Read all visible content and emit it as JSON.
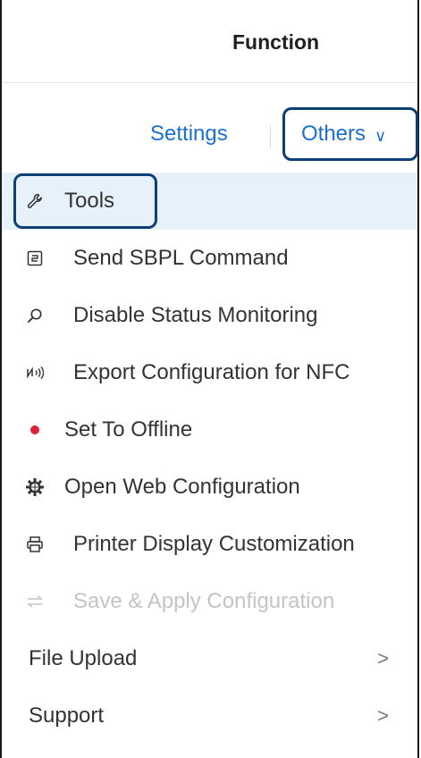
{
  "header": {
    "title": "Function"
  },
  "tabs": {
    "settings_label": "Settings",
    "others_label": "Others",
    "others_chevron": "∨"
  },
  "menu": {
    "items": [
      {
        "label": "Tools",
        "icon": "wrench-icon",
        "state": "selected"
      },
      {
        "label": "Send SBPL Command",
        "icon": "command-icon",
        "state": "normal"
      },
      {
        "label": "Disable Status Monitoring",
        "icon": "magnifier-icon",
        "state": "normal"
      },
      {
        "label": "Export Configuration for NFC",
        "icon": "nfc-icon",
        "state": "normal"
      },
      {
        "label": "Set To Offline",
        "icon": "status-dot-icon",
        "state": "normal"
      },
      {
        "label": "Open Web Configuration",
        "icon": "web-gear-icon",
        "state": "normal"
      },
      {
        "label": "Printer Display Customization",
        "icon": "printer-icon",
        "state": "normal"
      },
      {
        "label": "Save & Apply Configuration",
        "icon": "swap-arrows-icon",
        "state": "disabled"
      },
      {
        "label": "File Upload",
        "icon": "",
        "state": "submenu",
        "arrow": ">"
      },
      {
        "label": "Support",
        "icon": "",
        "state": "submenu",
        "arrow": ">"
      }
    ]
  },
  "colors": {
    "accent": "#1b6fd1",
    "highlight_border": "#0d3f77",
    "selected_bg": "#e6f1fb",
    "status_dot": "#e0203a",
    "disabled_text": "#c4c4c4"
  }
}
